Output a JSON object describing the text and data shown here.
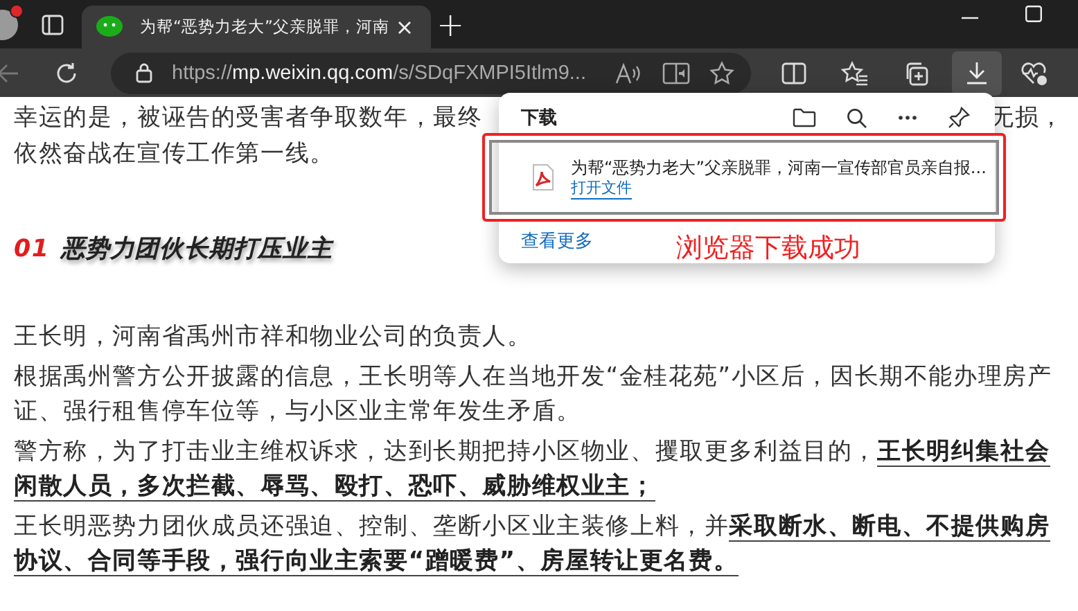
{
  "browser": {
    "tab": {
      "title": "为帮“恶势力老大”父亲脱罪，河南",
      "selected": true
    },
    "new_tab": "+",
    "address": {
      "scheme": "https://",
      "domain": "mp.weixin.qq.com",
      "path": "/s/SDqFXMPI5Itlm9..."
    }
  },
  "article": {
    "covered_paragraph": {
      "line_start": "幸运的是，被诬告的受害者争取数年，最终",
      "line_end": "无损，",
      "line_2": "依然奋战在宣传工作第一线。"
    },
    "heading": {
      "number": "01",
      "text": "恶势力团伙长期打压业主"
    },
    "paragraphs": [
      "王长明，河南省禹州市祥和物业公司的负责人。",
      "根据禹州警方公开披露的信息，王长明等人在当地开发“金桂花苑”小区后，因长期不能办理房产证、强行租售停车位等，与小区业主常年发生矛盾。",
      "警方称，为了打击业主维权诉求，达到长期把持小区物业、攫取更多利益目的，**王长明纠集社会闲散人员，多次拦截、辱骂、殴打、恐吓、威胁维权业主；**",
      "王长明恶势力团伙成员还强迫、控制、垄断小区业主装修上料，并**采取断水、断电、不提供购房协议、合同等手段，强行向业主索要“蹭暖费”、房屋转让更名费。**"
    ]
  },
  "downloads": {
    "title": "下载",
    "item": {
      "file_name": "为帮“恶势力老大”父亲脱罪，河南一宣传部官员亲自报...",
      "action": "打开文件"
    },
    "see_more": "查看更多"
  },
  "annotation": "浏览器下载成功"
}
